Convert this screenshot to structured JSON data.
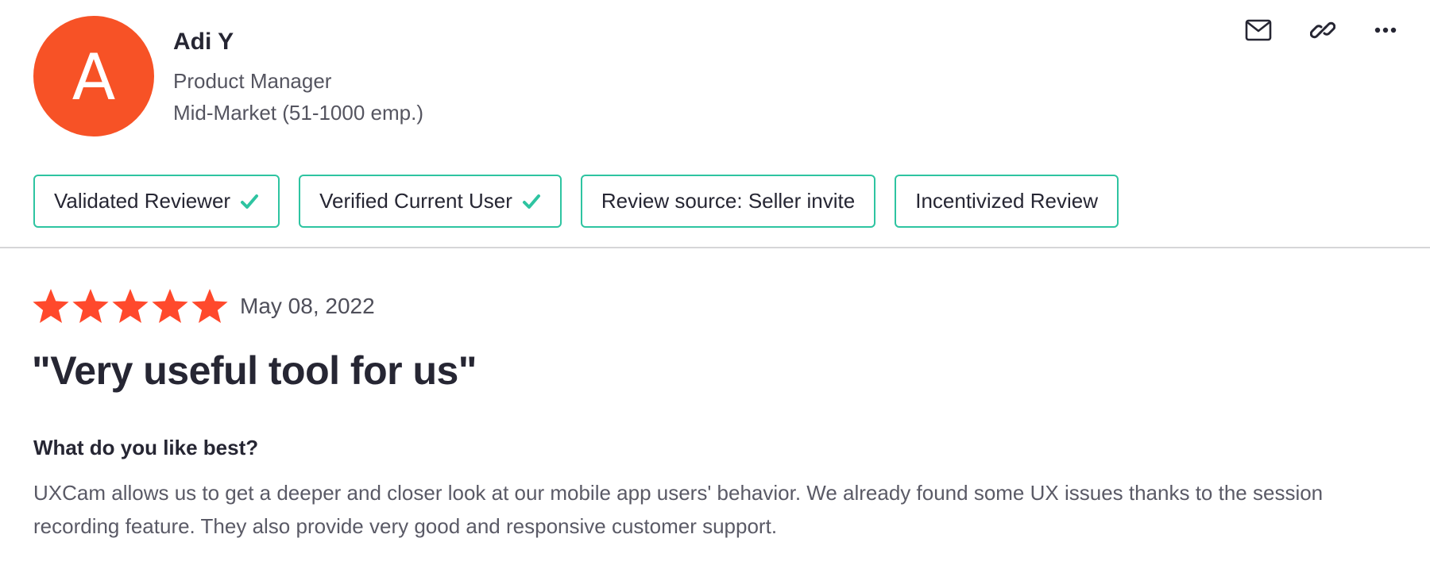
{
  "reviewer": {
    "avatar_initial": "A",
    "avatar_color": "#f75226",
    "name": "Adi Y",
    "role": "Product Manager",
    "segment": "Mid-Market (51-1000 emp.)"
  },
  "actions": [
    {
      "icon": "mail-icon"
    },
    {
      "icon": "link-icon"
    },
    {
      "icon": "more-icon"
    }
  ],
  "badges": [
    {
      "label": "Validated Reviewer",
      "checked": true
    },
    {
      "label": "Verified Current User",
      "checked": true
    },
    {
      "label": "Review source: Seller invite",
      "checked": false
    },
    {
      "label": "Incentivized Review",
      "checked": false
    }
  ],
  "colors": {
    "accent": "#2ec4a1",
    "star": "#ff492c",
    "avatar": "#f75226"
  },
  "review": {
    "rating": 5,
    "rating_max": 5,
    "date": "May 08, 2022",
    "title": "\"Very useful tool for us\"",
    "question": "What do you like best?",
    "answer": "UXCam allows us to get a deeper and closer look at our mobile app users' behavior. We already found some UX issues thanks to the session recording feature. They also provide very good and responsive customer support."
  }
}
